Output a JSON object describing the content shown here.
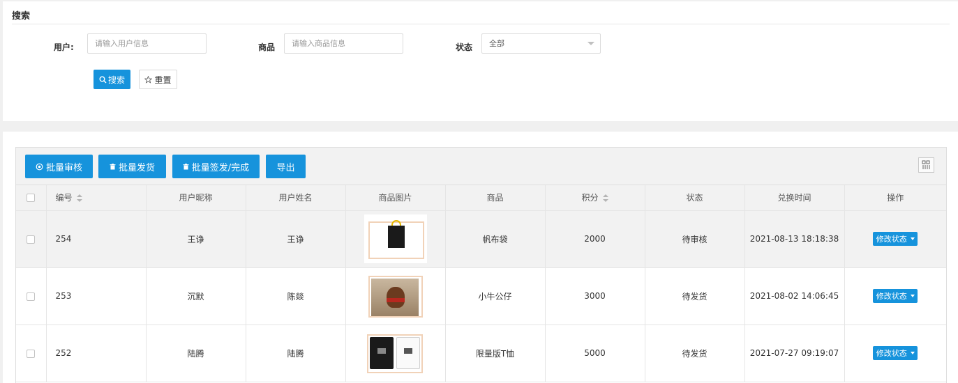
{
  "search": {
    "title": "搜索",
    "user_label": "用户:",
    "user_placeholder": "请输入用户信息",
    "product_label": "商品",
    "product_placeholder": "请输入商品信息",
    "status_label": "状态",
    "status_value": "全部",
    "search_btn": "搜索",
    "reset_btn": "重置"
  },
  "toolbar": {
    "batch_review": "批量审核",
    "batch_ship": "批量发货",
    "batch_sign": "批量签发/完成",
    "export": "导出"
  },
  "table": {
    "columns": [
      "编号",
      "用户昵称",
      "用户姓名",
      "商品图片",
      "商品",
      "积分",
      "状态",
      "兑换时间",
      "操作"
    ],
    "rows": [
      {
        "id": "254",
        "nickname": "王诤",
        "name": "王诤",
        "product": "帆布袋",
        "points": "2000",
        "status": "待审核",
        "time": "2021-08-13 18:18:38",
        "action": "修改状态"
      },
      {
        "id": "253",
        "nickname": "沉默",
        "name": "陈燚",
        "product": "小牛公仔",
        "points": "3000",
        "status": "待发货",
        "time": "2021-08-02 14:06:45",
        "action": "修改状态"
      },
      {
        "id": "252",
        "nickname": "陆腾",
        "name": "陆腾",
        "product": "限量版T恤",
        "points": "5000",
        "status": "待发货",
        "time": "2021-07-27 09:19:07",
        "action": "修改状态"
      }
    ]
  },
  "colors": {
    "primary": "#1693dc",
    "header_bg": "#f2f2f2"
  }
}
